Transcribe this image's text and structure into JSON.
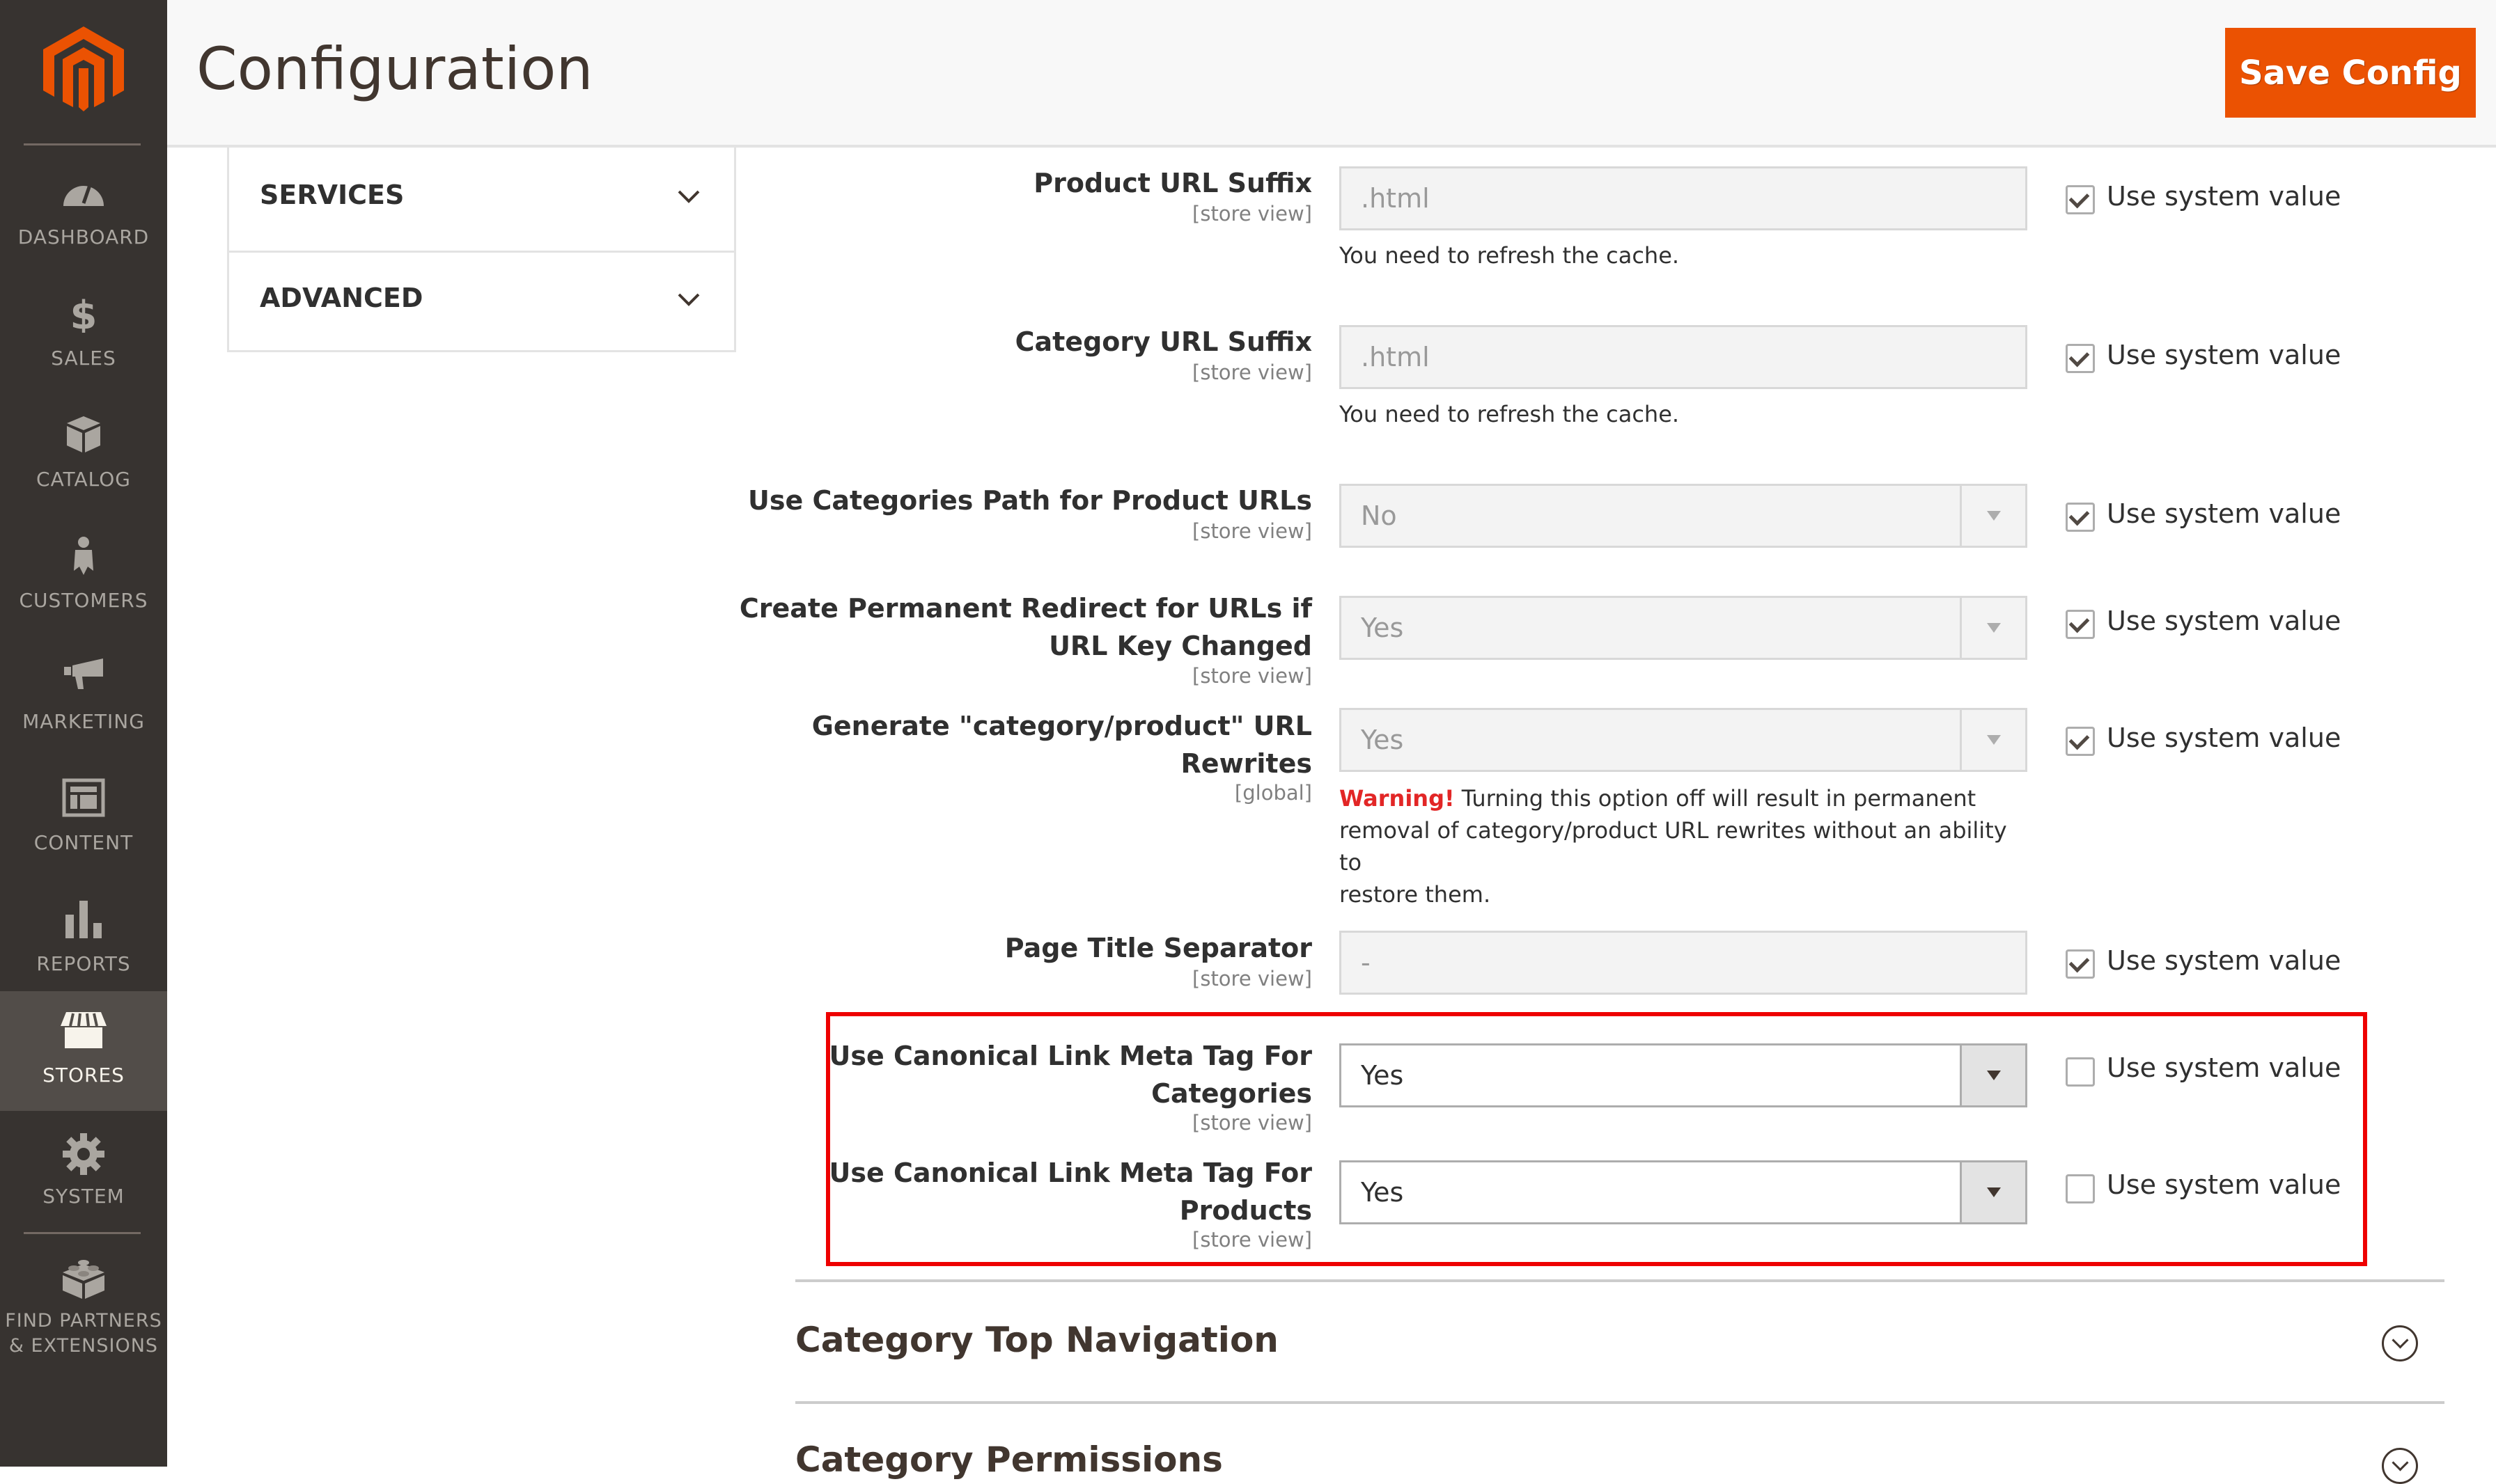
{
  "header": {
    "title": "Configuration",
    "save_label": "Save Config"
  },
  "sidebar": {
    "items": [
      {
        "label": "DASHBOARD",
        "icon": "dashboard-icon"
      },
      {
        "label": "SALES",
        "icon": "dollar-icon"
      },
      {
        "label": "CATALOG",
        "icon": "box-icon"
      },
      {
        "label": "CUSTOMERS",
        "icon": "person-icon"
      },
      {
        "label": "MARKETING",
        "icon": "megaphone-icon"
      },
      {
        "label": "CONTENT",
        "icon": "layout-icon"
      },
      {
        "label": "REPORTS",
        "icon": "bar-chart-icon"
      },
      {
        "label": "STORES",
        "icon": "storefront-icon",
        "active": true
      },
      {
        "label": "SYSTEM",
        "icon": "gear-icon"
      },
      {
        "label_line1": "FIND PARTNERS",
        "label_line2": "& EXTENSIONS",
        "icon": "lego-brick-icon"
      }
    ]
  },
  "config_tabs": [
    {
      "label": "SERVICES"
    },
    {
      "label": "ADVANCED"
    }
  ],
  "fields": [
    {
      "label": "Product URL Suffix",
      "scope": "[store view]",
      "value": ".html",
      "type": "text",
      "note": "You need to refresh the cache.",
      "use_system": true
    },
    {
      "label": "Category URL Suffix",
      "scope": "[store view]",
      "value": ".html",
      "type": "text",
      "note": "You need to refresh the cache.",
      "use_system": true
    },
    {
      "label": "Use Categories Path for Product URLs",
      "scope": "[store view]",
      "value": "No",
      "type": "select",
      "use_system": true
    },
    {
      "label_line1": "Create Permanent Redirect for URLs if",
      "label_line2": "URL Key Changed",
      "scope": "[store view]",
      "value": "Yes",
      "type": "select",
      "use_system": true
    },
    {
      "label_line1": "Generate \"category/product\" URL",
      "label_line2": "Rewrites",
      "scope": "[global]",
      "value": "Yes",
      "type": "select",
      "use_system": true,
      "warning_prefix": "Warning!",
      "warning_line1": " Turning this option off will result in permanent",
      "warning_line2": "removal of category/product URL rewrites without an ability to",
      "warning_line3": "restore them."
    },
    {
      "label": "Page Title Separator",
      "scope": "[store view]",
      "value": "-",
      "type": "text",
      "use_system": true
    },
    {
      "label_line1": "Use Canonical Link Meta Tag For",
      "label_line2": "Categories",
      "scope": "[store view]",
      "value": "Yes",
      "type": "select",
      "use_system": false
    },
    {
      "label_line1": "Use Canonical Link Meta Tag For",
      "label_line2": "Products",
      "scope": "[store view]",
      "value": "Yes",
      "type": "select",
      "use_system": false
    }
  ],
  "use_system_label": "Use system value",
  "sections": [
    {
      "title": "Category Top Navigation"
    },
    {
      "title": "Category Permissions"
    }
  ],
  "colors": {
    "accent": "#eb5202",
    "sidebar": "#373330",
    "highlight": "#ee0000",
    "warning": "#e22626"
  }
}
